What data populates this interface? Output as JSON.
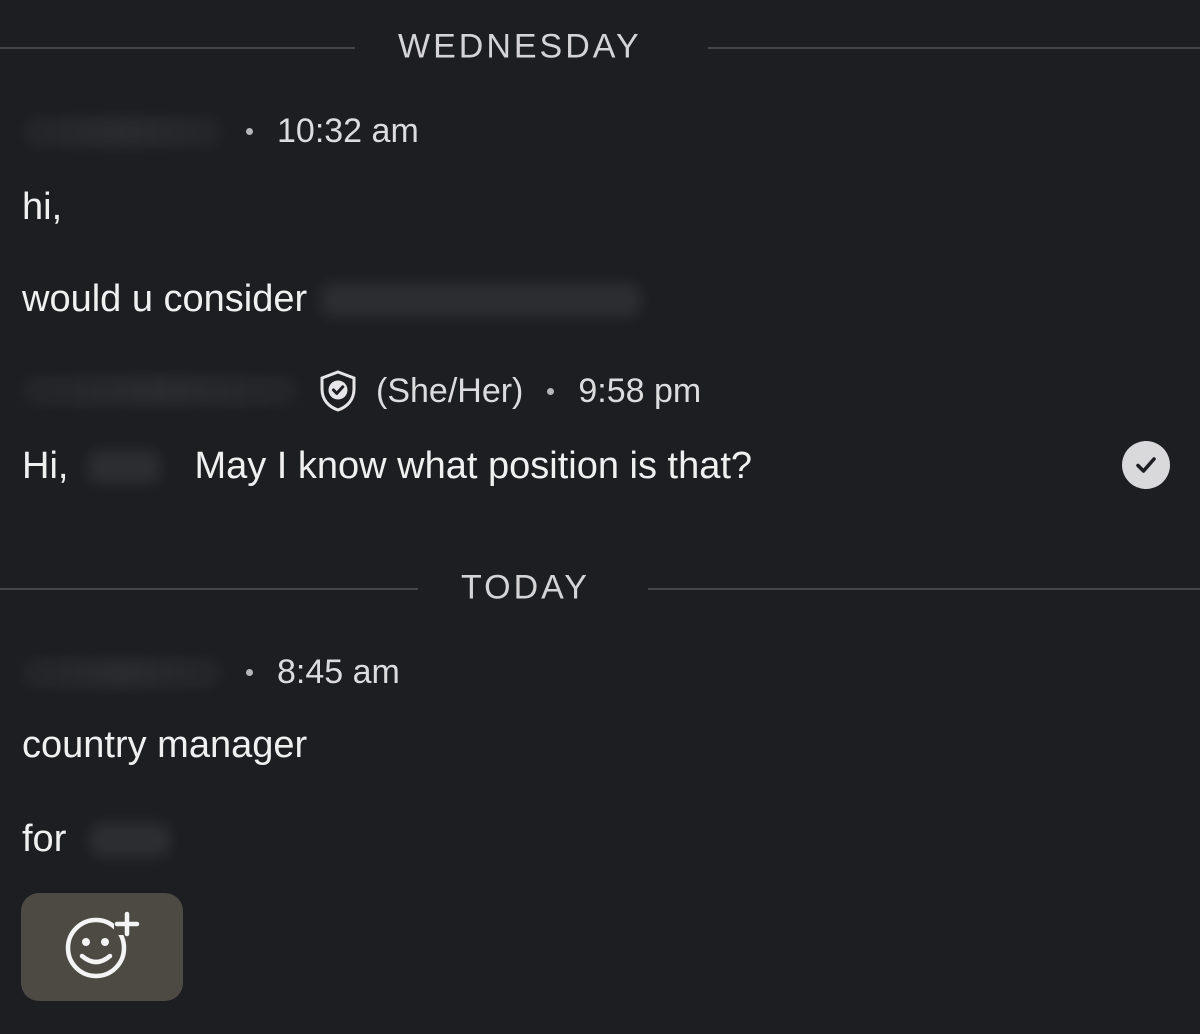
{
  "conversation": {
    "dividers": {
      "wednesday": "WEDNESDAY",
      "today": "TODAY"
    },
    "groups": [
      {
        "time": "10:32 am",
        "messages": [
          "hi,",
          "would u consider"
        ]
      },
      {
        "pronouns": "(She/Her)",
        "time": "9:58 pm",
        "message_greeting": "Hi,",
        "message_body": "May I know what position is that?",
        "verified_icon": "shield-check-icon",
        "read_receipt_icon": "check-circle-icon"
      },
      {
        "time": "8:45 am",
        "messages": [
          "country manager",
          "for"
        ]
      }
    ],
    "reaction_button_icon": "add-emoji-icon"
  },
  "colors": {
    "background": "#1d1e22",
    "divider_line": "#45464b",
    "text": "#f0f0f1",
    "reaction_button_bg": "#4d4943"
  }
}
